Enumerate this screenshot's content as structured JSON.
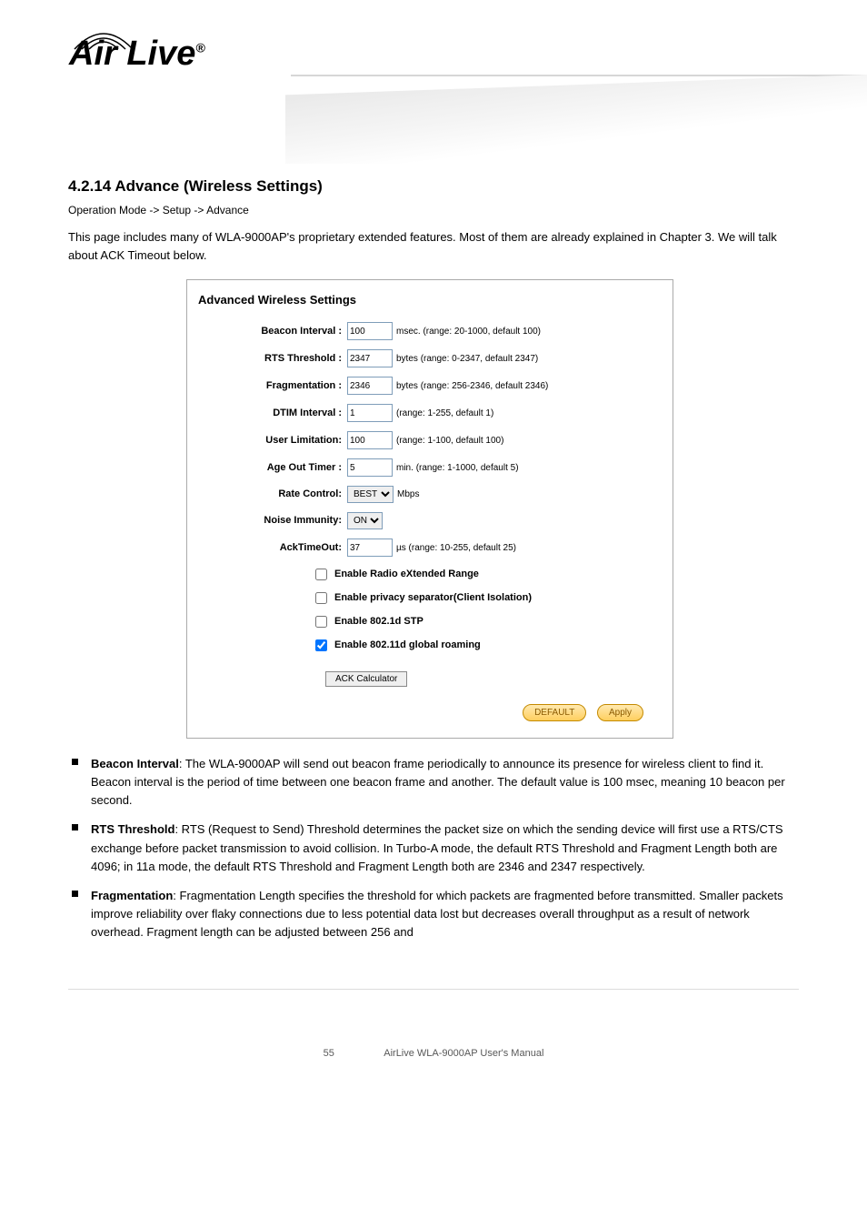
{
  "header": {
    "logo_text": "Air Live",
    "logo_reg": "®"
  },
  "page": {
    "title_number": "4.2.14",
    "title_text": "Advance (Wireless Settings)",
    "subtitle_path": "Operation Mode -> Setup -> Advance",
    "intro": "This page includes many of WLA-9000AP's proprietary extended features. Most of them are already explained in Chapter 3. We will talk about ACK Timeout below."
  },
  "panel": {
    "title": "Advanced Wireless Settings",
    "rows": {
      "beacon": {
        "label": "Beacon Interval :",
        "value": "100",
        "unit": "msec.",
        "hint": "(range: 20-1000, default 100)"
      },
      "rts": {
        "label": "RTS Threshold :",
        "value": "2347",
        "unit": "bytes",
        "hint": "(range: 0-2347, default 2347)"
      },
      "frag": {
        "label": "Fragmentation :",
        "value": "2346",
        "unit": "bytes",
        "hint": "(range: 256-2346, default 2346)"
      },
      "dtim": {
        "label": "DTIM Interval :",
        "value": "1",
        "unit": "",
        "hint": "(range: 1-255, default 1)"
      },
      "userlim": {
        "label": "User Limitation:",
        "value": "100",
        "unit": "",
        "hint": "(range: 1-100, default 100)"
      },
      "ageout": {
        "label": "Age Out Timer :",
        "value": "5",
        "unit": "min.",
        "hint": "(range: 1-1000, default 5)"
      },
      "rate": {
        "label": "Rate Control:",
        "value": "BEST",
        "unit": "Mbps",
        "hint": ""
      },
      "noise": {
        "label": "Noise Immunity:",
        "value": "ON",
        "unit": "",
        "hint": ""
      },
      "ack": {
        "label": "AckTimeOut:",
        "value": "37",
        "unit": "µs",
        "hint": "(range: 10-255, default 25)"
      }
    },
    "checks": {
      "xrange": {
        "label": "Enable Radio eXtended Range",
        "checked": false
      },
      "privacy": {
        "label": "Enable privacy separator(Client Isolation)",
        "checked": false
      },
      "stp": {
        "label": "Enable 802.1d STP",
        "checked": false
      },
      "roaming": {
        "label": "Enable 802.11d global roaming",
        "checked": true
      }
    },
    "ack_btn": "ACK Calculator",
    "default_btn": "DEFAULT",
    "apply_btn": "Apply"
  },
  "bullets": {
    "b1": {
      "head": "Beacon Interval",
      "text": ": The WLA-9000AP will send out beacon frame periodically to announce its presence for wireless client to find it. Beacon interval is the period of time between one beacon frame and another. The default value is 100 msec, meaning 10 beacon per second."
    },
    "b2": {
      "head": "RTS Threshold",
      "text": ": RTS (Request to Send) Threshold determines the packet size on which the sending device will first use a RTS/CTS exchange before packet transmission to avoid collision. In Turbo-A mode, the default RTS Threshold and Fragment Length both are 4096; in 11a mode, the default RTS Threshold and Fragment Length both are 2346 and 2347 respectively."
    },
    "b3": {
      "head": "Fragmentation",
      "text": ": Fragmentation Length specifies the threshold for which packets are fragmented before transmitted. Smaller packets improve reliability over flaky connections due to less potential data lost but decreases overall throughput as a result of network overhead. Fragment length can be adjusted between 256 and"
    }
  },
  "footer": {
    "page": "55",
    "text": "AirLive WLA-9000AP User's Manual"
  }
}
